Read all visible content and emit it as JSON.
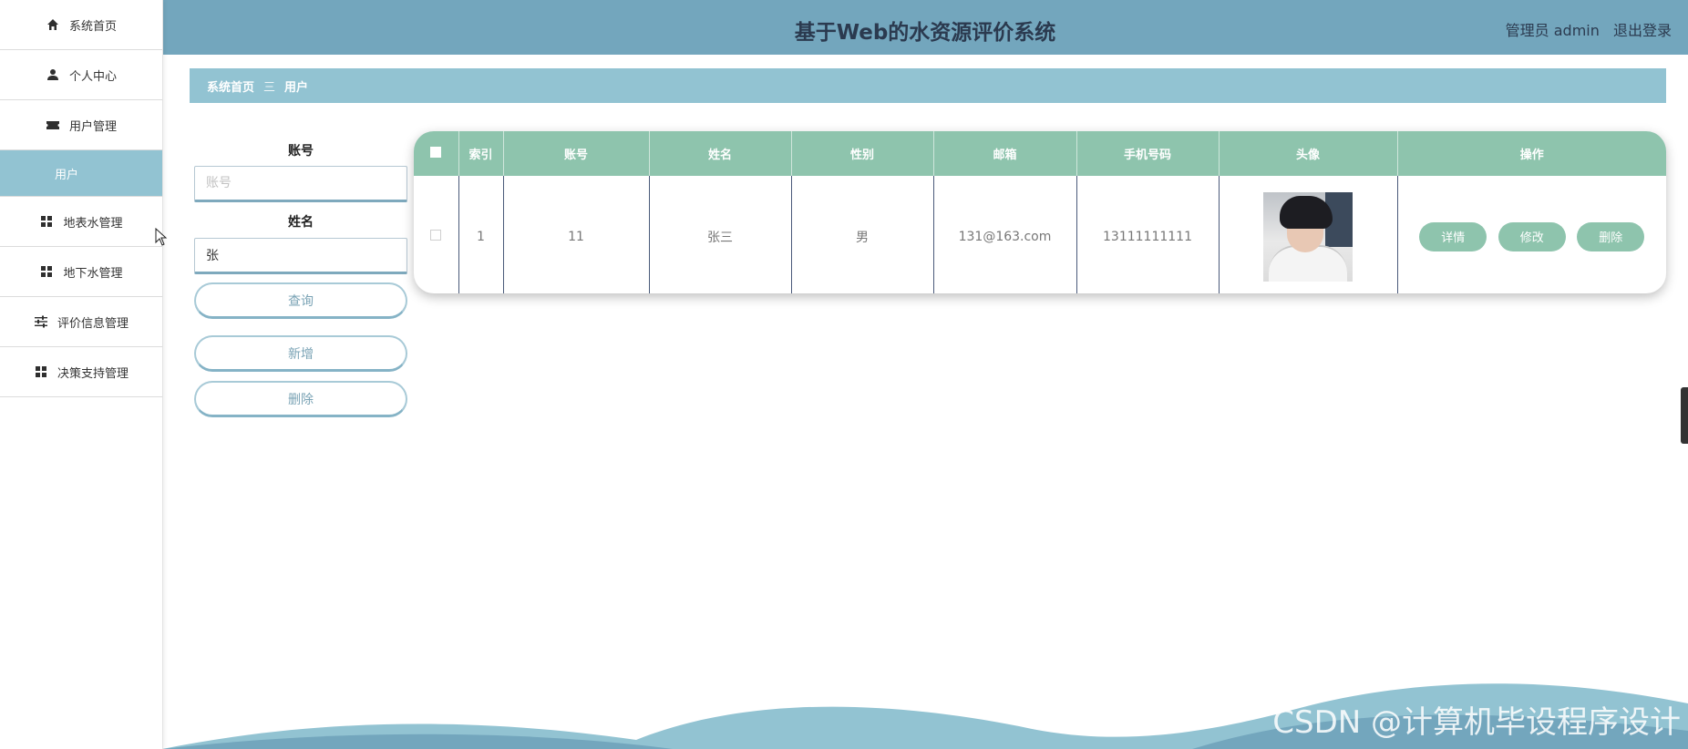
{
  "header": {
    "title": "基于Web的水资源评价系统",
    "user": "管理员 admin",
    "logout": "退出登录"
  },
  "sidebar": {
    "items": [
      {
        "label": "系统首页",
        "icon": "home-icon"
      },
      {
        "label": "个人中心",
        "icon": "user-icon"
      },
      {
        "label": "用户管理",
        "icon": "ticket-icon"
      },
      {
        "label": "地表水管理",
        "icon": "grid-icon"
      },
      {
        "label": "地下水管理",
        "icon": "grid-icon"
      },
      {
        "label": "评价信息管理",
        "icon": "sliders-icon"
      },
      {
        "label": "决策支持管理",
        "icon": "grid-icon"
      }
    ],
    "sub_item": "用户"
  },
  "breadcrumb": {
    "home": "系统首页",
    "separator": "三",
    "current": "用户"
  },
  "search": {
    "account_label": "账号",
    "account_placeholder": "账号",
    "account_value": "",
    "name_label": "姓名",
    "name_value": "张",
    "query_button": "查询",
    "add_button": "新增",
    "delete_button": "删除"
  },
  "table": {
    "headers": [
      "",
      "索引",
      "账号",
      "姓名",
      "性别",
      "邮箱",
      "手机号码",
      "头像",
      "操作"
    ],
    "rows": [
      {
        "index": "1",
        "account": "11",
        "name": "张三",
        "gender": "男",
        "email": "131@163.com",
        "phone": "13111111111",
        "actions": [
          "详情",
          "修改",
          "删除"
        ]
      }
    ]
  },
  "watermark": "CSDN @计算机毕设程序设计",
  "colors": {
    "header": "#73a6bd",
    "accent": "#92c3d2",
    "table_header": "#8ec4ad"
  }
}
